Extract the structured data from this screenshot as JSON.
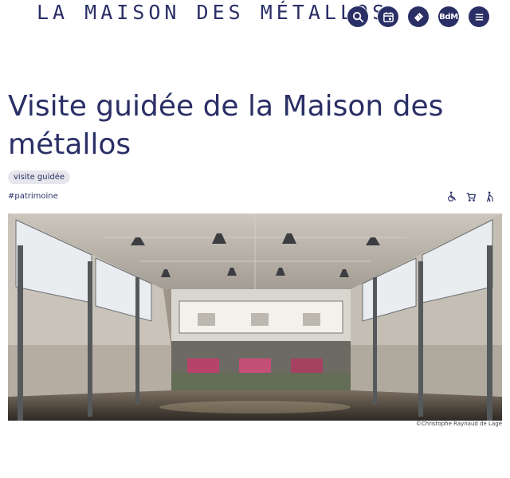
{
  "header": {
    "logo": "LA MAISON DES MÉTALLOS",
    "nav": [
      {
        "icon": "search-icon"
      },
      {
        "icon": "calendar-icon"
      },
      {
        "icon": "ticket-icon"
      },
      {
        "label": "BdM"
      },
      {
        "icon": "menu-icon"
      }
    ]
  },
  "page": {
    "title": "Visite guidée de la Maison des métallos",
    "tag": "visite guidée",
    "hashtag": "#patrimoine",
    "accessibility_icons": [
      "wheelchair-icon",
      "stroller-icon",
      "elderly-walking-icon"
    ]
  },
  "image": {
    "credit": "©Christophe Raynaud de Lage"
  },
  "colors": {
    "brand": "#2a2f66",
    "tag_bg": "#e6e6ec"
  }
}
